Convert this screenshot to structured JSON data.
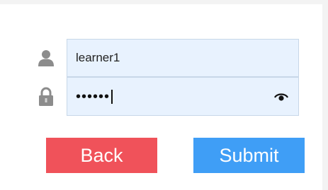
{
  "login_form": {
    "username": {
      "icon": "user-icon",
      "value": "learner1"
    },
    "password": {
      "icon": "lock-icon",
      "masked_value": "••••••",
      "visibility_icon": "eye-icon"
    },
    "buttons": {
      "back_label": "Back",
      "submit_label": "Submit"
    }
  },
  "colors": {
    "input_background": "#e8f2fe",
    "back_button": "#f0525a",
    "submit_button": "#3f9ef6",
    "icon_gray": "#8c8c8c"
  }
}
